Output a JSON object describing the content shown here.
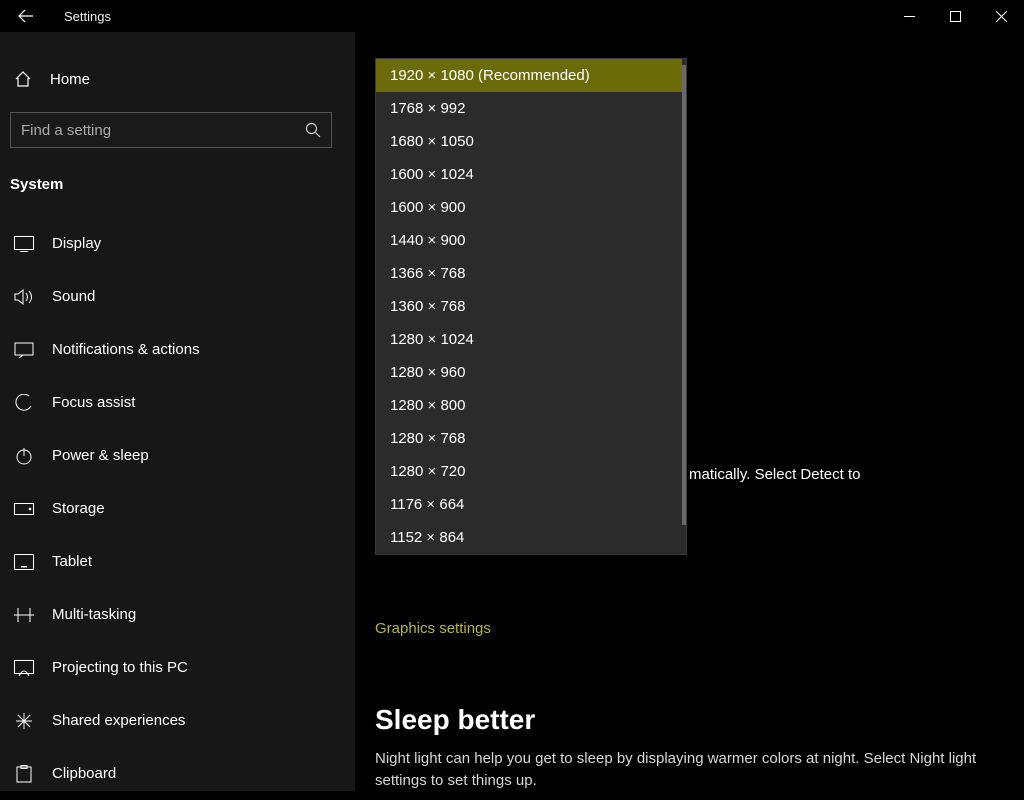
{
  "titlebar": {
    "title": "Settings"
  },
  "sidebar": {
    "home_label": "Home",
    "search_placeholder": "Find a setting",
    "group_title": "System",
    "items": [
      {
        "label": "Display",
        "icon": "display-icon"
      },
      {
        "label": "Sound",
        "icon": "sound-icon"
      },
      {
        "label": "Notifications & actions",
        "icon": "notifications-icon"
      },
      {
        "label": "Focus assist",
        "icon": "focus-icon"
      },
      {
        "label": "Power & sleep",
        "icon": "power-icon"
      },
      {
        "label": "Storage",
        "icon": "storage-icon"
      },
      {
        "label": "Tablet",
        "icon": "tablet-icon"
      },
      {
        "label": "Multi-tasking",
        "icon": "multitasking-icon"
      },
      {
        "label": "Projecting to this PC",
        "icon": "projecting-icon"
      },
      {
        "label": "Shared experiences",
        "icon": "shared-icon"
      },
      {
        "label": "Clipboard",
        "icon": "clipboard-icon"
      }
    ]
  },
  "resolution_dropdown": {
    "options": [
      "1920 × 1080 (Recommended)",
      "1768 × 992",
      "1680 × 1050",
      "1600 × 1024",
      "1600 × 900",
      "1440 × 900",
      "1366 × 768",
      "1360 × 768",
      "1280 × 1024",
      "1280 × 960",
      "1280 × 800",
      "1280 × 768",
      "1280 × 720",
      "1176 × 664",
      "1152 × 864"
    ],
    "selected_index": 0
  },
  "content": {
    "partial_behind_text": "matically. Select Detect to",
    "graphics_link": "Graphics settings",
    "sleep_heading": "Sleep better",
    "sleep_body": "Night light can help you get to sleep by displaying warmer colors at night. Select Night light settings to set things up."
  }
}
